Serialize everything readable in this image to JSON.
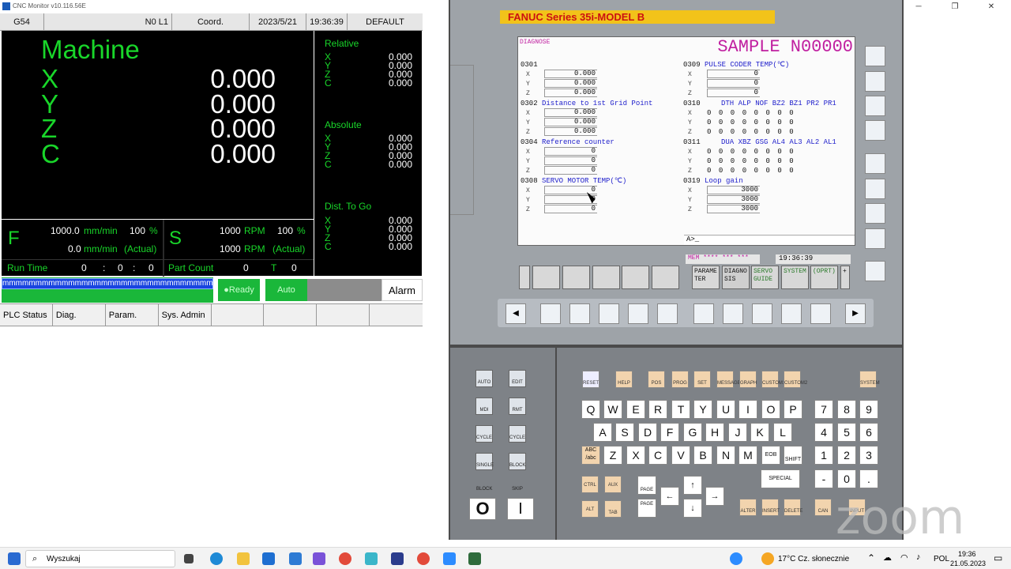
{
  "window": {
    "title": "CNC Monitor v10.116.56E"
  },
  "header": {
    "wcs": "G54",
    "tool": "N0 L1",
    "coord_btn": "Coord.",
    "date": "2023/5/21",
    "time": "19:36:39",
    "mode": "DEFAULT"
  },
  "machine": {
    "label": "Machine",
    "axes": [
      "X",
      "Y",
      "Z",
      "C"
    ],
    "values": [
      "0.000",
      "0.000",
      "0.000",
      "0.000"
    ]
  },
  "relative": {
    "label": "Relative",
    "values": [
      "0.000",
      "0.000",
      "0.000",
      "0.000"
    ]
  },
  "absolute": {
    "label": "Absolute",
    "values": [
      "0.000",
      "0.000",
      "0.000",
      "0.000"
    ]
  },
  "dist_to_go": {
    "label": "Dist. To Go",
    "values": [
      "0.000",
      "0.000",
      "0.000",
      "0.000"
    ]
  },
  "feed": {
    "label": "F",
    "cmd": "1000.0",
    "actual": "0.0",
    "unit": "mm/min",
    "override": "100",
    "pct": "%",
    "actual_label": "(Actual)"
  },
  "spindle": {
    "label": "S",
    "cmd": "1000",
    "actual": "1000",
    "unit": "RPM",
    "override": "100",
    "pct": "%",
    "actual_label": "(Actual)"
  },
  "runtime": {
    "label": "Run Time",
    "h": "0",
    "sep": ":",
    "m": "0",
    "s": "0"
  },
  "partcount": {
    "label": "Part Count",
    "value": "0",
    "t_label": "T",
    "t_value": "0"
  },
  "progress_text": "mmmmmmmmmmmmmmmmmmmmmmmmmmmmmmmmmmmmm",
  "status": {
    "ready": "●Ready",
    "auto": "Auto",
    "alarm": "Alarm"
  },
  "tabs": [
    "PLC Status",
    "Diag.",
    "Param.",
    "Sys. Admin"
  ],
  "fanuc": {
    "brand": "FANUC Series 35i-MODEL B",
    "screen_title": "DIAGNOSE",
    "program": "SAMPLE N00000",
    "d0301": {
      "num": "0301",
      "title": "",
      "values": [
        "0.000",
        "0.000",
        "0.000"
      ]
    },
    "d0302": {
      "num": "0302",
      "title": "Distance to 1st Grid Point",
      "values": [
        "0.000",
        "0.000",
        "0.000"
      ]
    },
    "d0304": {
      "num": "0304",
      "title": "Reference counter",
      "values": [
        "0",
        "0",
        "0"
      ]
    },
    "d0308": {
      "num": "0308",
      "title": "SERVO MOTOR TEMP(℃)",
      "values": [
        "0",
        "0",
        "0"
      ]
    },
    "d0309": {
      "num": "0309",
      "title": "PULSE CODER TEMP(℃)",
      "values": [
        "0",
        "0",
        "0"
      ]
    },
    "d0310": {
      "num": "0310",
      "title": "DTH ALP NOF BZ2 BZ1 PR2 PR1",
      "bits": "00000000"
    },
    "d0311": {
      "num": "0311",
      "title": "DUA XBZ GSG AL4 AL3 AL2 AL1",
      "bits": "00000000"
    },
    "d0319": {
      "num": "0319",
      "title": "Loop gain",
      "values": [
        "3000",
        "3000",
        "3000"
      ]
    },
    "axes": [
      "X",
      "Y",
      "Z"
    ],
    "prompt": "A>_",
    "mode_line": "MEM **** *** ***",
    "clock": "19:36:39",
    "softkeys": [
      "PARAME TER",
      "DIAGNO SIS",
      "SERVO GUIDE",
      "SYSTEM",
      "(OPRT)",
      "+"
    ],
    "letters_row1": [
      "Q",
      "W",
      "E",
      "R",
      "T",
      "Y",
      "U",
      "I",
      "O",
      "P"
    ],
    "letters_row2": [
      "A",
      "S",
      "D",
      "F",
      "G",
      "H",
      "J",
      "K",
      "L"
    ],
    "letters_row3": [
      "Z",
      "X",
      "C",
      "V",
      "B",
      "N",
      "M"
    ],
    "digits": [
      "7",
      "8",
      "9",
      "4",
      "5",
      "6",
      "1",
      "2",
      "3",
      "-",
      "0",
      "."
    ],
    "func_keys": [
      "RESET",
      "HELP",
      "POS",
      "PROG",
      "SET",
      "MESSAGE",
      "GRAPH",
      "CUSTOM1",
      "CUSTOM2",
      "SYSTEM"
    ],
    "edit_keys": [
      "ALTER",
      "INSERT",
      "DELETE",
      "CAN",
      "INPUT"
    ],
    "misc_keys": [
      "CTRL",
      "AUX",
      "ALT",
      "TAB",
      "SHIFT",
      "EOB",
      "SPECIAL",
      "PAGE",
      "PAGE"
    ],
    "mode_keys": [
      "AUTO",
      "EDIT",
      "MDI",
      "RMT",
      "CYCLE START",
      "CYCLE STOP",
      "SINGLE BLOCK",
      "BLOCK SKIP"
    ],
    "power": [
      "O",
      "I"
    ]
  },
  "taskbar": {
    "search": "Wyszukaj",
    "weather": "17°C  Cz. słonecznie",
    "lang": "POL",
    "time": "19:36",
    "date": "21.05.2023"
  },
  "watermark": "zoom",
  "colors": {
    "cnc_green": "#19d62a",
    "fanuc_yellow": "#f2c31a",
    "diag_magenta": "#c01fa0",
    "progress_blue": "#1944e0"
  }
}
